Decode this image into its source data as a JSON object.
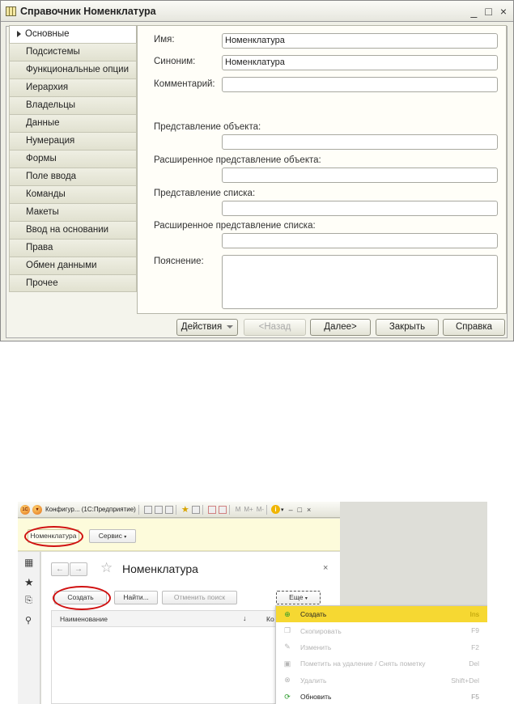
{
  "top_window": {
    "title": "Справочник Номенклатура",
    "window_controls": [
      "_",
      "□",
      "×"
    ],
    "tabs": [
      "Основные",
      "Подсистемы",
      "Функциональные опции",
      "Иерархия",
      "Владельцы",
      "Данные",
      "Нумерация",
      "Формы",
      "Поле ввода",
      "Команды",
      "Макеты",
      "Ввод на основании",
      "Права",
      "Обмен данными",
      "Прочее"
    ],
    "active_tab": "Основные",
    "fields": {
      "name_label": "Имя:",
      "name_value": "Номенклатура",
      "synonym_label": "Синоним:",
      "synonym_value": "Номенклатура",
      "comment_label": "Комментарий:",
      "comment_value": "",
      "object_presentation_label": "Представление объекта:",
      "ext_object_presentation_label": "Расширенное представление объекта:",
      "list_presentation_label": "Представление списка:",
      "ext_list_presentation_label": "Расширенное представление списка:",
      "explanation_label": "Пояснение:"
    },
    "buttons": {
      "actions": "Действия",
      "back": "<Назад",
      "next": "Далее>",
      "close": "Закрыть",
      "help": "Справка"
    }
  },
  "bottom_window": {
    "toolbar": {
      "app_title": "Конфигур... (1С:Предприятие)",
      "logo_text": "1С",
      "memory_buttons": [
        "M",
        "M+",
        "M-"
      ],
      "window_controls": [
        "–",
        "□",
        "×"
      ]
    },
    "section_bar": {
      "current_section": "Номенклатура",
      "service_label": "Сервис"
    },
    "form": {
      "title": "Номенклатура",
      "close_symbol": "×",
      "buttons": {
        "create": "Создать",
        "find": "Найти...",
        "cancel_search": "Отменить поиск",
        "more": "Еще"
      },
      "table_columns": [
        "Наименование",
        "↓",
        "Ко"
      ]
    },
    "context_menu": {
      "items": [
        {
          "label": "Создать",
          "shortcut": "Ins",
          "icon": "plus-circle-icon",
          "state": "highlighted"
        },
        {
          "label": "Скопировать",
          "shortcut": "F9",
          "icon": "copy-icon",
          "state": "disabled"
        },
        {
          "label": "Изменить",
          "shortcut": "F2",
          "icon": "pencil-icon",
          "state": "disabled"
        },
        {
          "label": "Пометить на удаление / Снять пометку",
          "shortcut": "Del",
          "icon": "mark-delete-icon",
          "state": "disabled"
        },
        {
          "label": "Удалить",
          "shortcut": "Shift+Del",
          "icon": "delete-icon",
          "state": "disabled"
        },
        {
          "label": "Обновить",
          "shortcut": "F5",
          "icon": "refresh-icon",
          "state": "enabled"
        }
      ]
    },
    "colors": {
      "highlight": "#f6d832",
      "annotation_oval": "#d01010",
      "section_bar": "#fdfbdb"
    }
  }
}
